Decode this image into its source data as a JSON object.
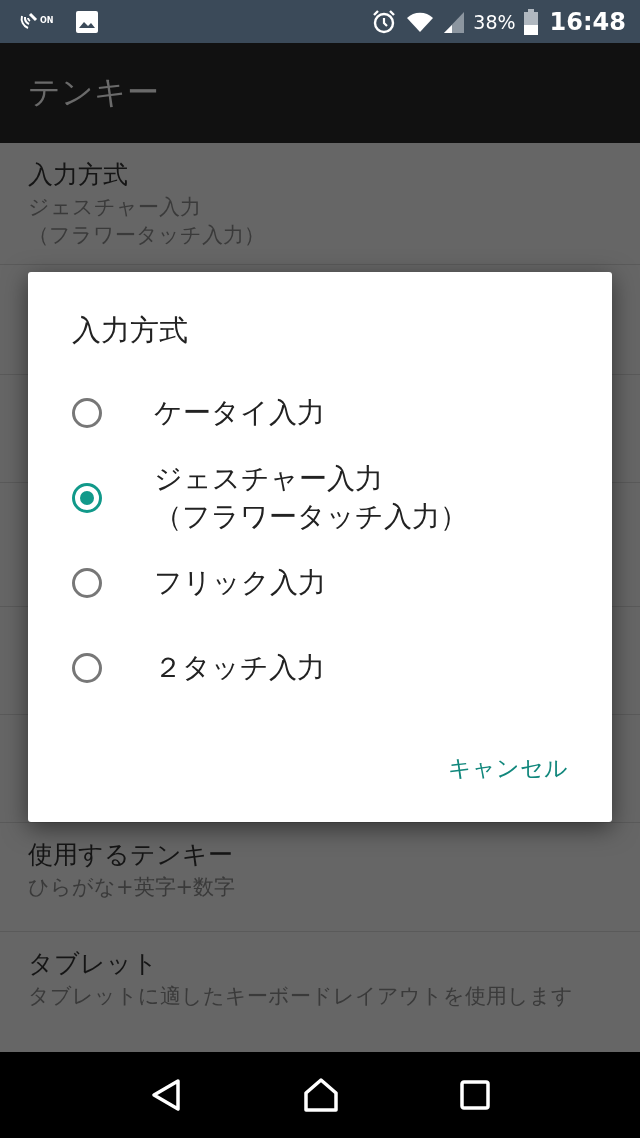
{
  "status_bar": {
    "nfc_label": "ON",
    "battery": "38%",
    "time": "16:48"
  },
  "app_bar": {
    "title": "テンキー"
  },
  "settings": [
    {
      "title": "入力方式",
      "summary_lines": [
        "ジェスチャー入力",
        "（フラワータッチ入力）"
      ],
      "kind": "visible"
    },
    {
      "kind": "hidden"
    },
    {
      "kind": "hidden"
    },
    {
      "kind": "hidden"
    },
    {
      "kind": "hidden"
    },
    {
      "kind": "hidden"
    },
    {
      "title": "使用するテンキー",
      "summary": "ひらがな+英字+数字",
      "kind": "visible"
    },
    {
      "title": "タブレット",
      "summary": "タブレットに適したキーボードレイアウトを使用します",
      "kind": "visible"
    }
  ],
  "dialog": {
    "title": "入力方式",
    "options": [
      {
        "label": "ケータイ入力",
        "selected": false
      },
      {
        "label_lines": [
          "ジェスチャー入力",
          "（フラワータッチ入力）"
        ],
        "selected": true
      },
      {
        "label": "フリック入力",
        "selected": false
      },
      {
        "label": "２タッチ入力",
        "selected": false
      }
    ],
    "cancel": "キャンセル"
  }
}
